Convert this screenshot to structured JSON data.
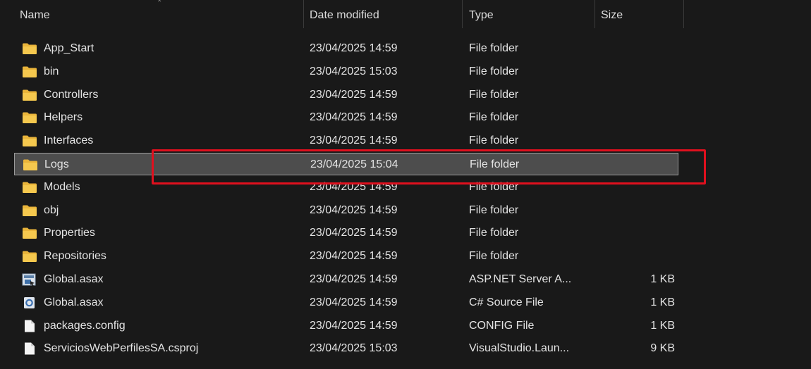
{
  "header": {
    "columns": {
      "name": "Name",
      "date": "Date modified",
      "type": "Type",
      "size": "Size"
    }
  },
  "colors": {
    "background": "#191919",
    "folder_yellow": "#f2c14e",
    "selection_bg": "#4d4d4d",
    "highlight_red": "#e0101e"
  },
  "files": [
    {
      "name": "App_Start",
      "date": "23/04/2025 14:59",
      "type": "File folder",
      "size": "",
      "icon": "folder-icon"
    },
    {
      "name": "bin",
      "date": "23/04/2025 15:03",
      "type": "File folder",
      "size": "",
      "icon": "folder-icon"
    },
    {
      "name": "Controllers",
      "date": "23/04/2025 14:59",
      "type": "File folder",
      "size": "",
      "icon": "folder-icon"
    },
    {
      "name": "Helpers",
      "date": "23/04/2025 14:59",
      "type": "File folder",
      "size": "",
      "icon": "folder-icon"
    },
    {
      "name": "Interfaces",
      "date": "23/04/2025 14:59",
      "type": "File folder",
      "size": "",
      "icon": "folder-icon"
    },
    {
      "name": "Logs",
      "date": "23/04/2025 15:04",
      "type": "File folder",
      "size": "",
      "icon": "folder-icon",
      "selected": true
    },
    {
      "name": "Models",
      "date": "23/04/2025 14:59",
      "type": "File folder",
      "size": "",
      "icon": "folder-icon"
    },
    {
      "name": "obj",
      "date": "23/04/2025 14:59",
      "type": "File folder",
      "size": "",
      "icon": "folder-icon"
    },
    {
      "name": "Properties",
      "date": "23/04/2025 14:59",
      "type": "File folder",
      "size": "",
      "icon": "folder-icon"
    },
    {
      "name": "Repositories",
      "date": "23/04/2025 14:59",
      "type": "File folder",
      "size": "",
      "icon": "folder-icon"
    },
    {
      "name": "Global.asax",
      "date": "23/04/2025 14:59",
      "type": "ASP.NET Server A...",
      "size": "1 KB",
      "icon": "asax-file-icon"
    },
    {
      "name": "Global.asax",
      "date": "23/04/2025 14:59",
      "type": "C# Source File",
      "size": "1 KB",
      "icon": "csharp-file-icon"
    },
    {
      "name": "packages.config",
      "date": "23/04/2025 14:59",
      "type": "CONFIG File",
      "size": "1 KB",
      "icon": "document-icon"
    },
    {
      "name": "ServiciosWebPerfilesSA.csproj",
      "date": "23/04/2025 15:03",
      "type": "VisualStudio.Laun...",
      "size": "9 KB",
      "icon": "document-icon"
    }
  ]
}
